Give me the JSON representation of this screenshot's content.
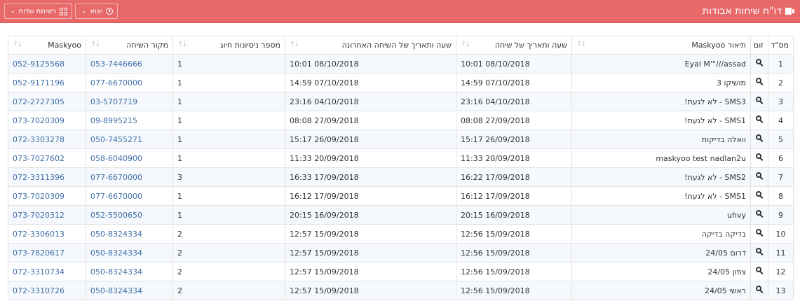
{
  "header": {
    "title": "דו\"ח שיחות אבודות",
    "export_label": "יצוא",
    "fields_label": "רשימת שדות"
  },
  "table": {
    "columns": {
      "index": "מס\"ד",
      "zoom": "זום",
      "maskyoo_desc": "תיאור Maskyoo",
      "call_time": "שעה ותאריך של שיחה",
      "last_call_time": "שעה ותאריך של השיחה האחרונה",
      "dial_attempts": "מספר ניסיונות חיוג",
      "call_source": "מקור השיחה",
      "maskyoo": "Maskyoo"
    },
    "rows": [
      {
        "index": "1",
        "desc": "Eyal M'\"///assad",
        "call_time": "08/10/2018 10:01",
        "last_time": "08/10/2018 10:01",
        "attempts": "1",
        "source": "053-7446666",
        "maskyoo": "052-9125568"
      },
      {
        "index": "2",
        "desc": "מושיקו 3",
        "call_time": "07/10/2018 14:59",
        "last_time": "07/10/2018 14:59",
        "attempts": "1",
        "source": "077-6670000",
        "maskyoo": "052-9171196"
      },
      {
        "index": "3",
        "desc": "SMS3 - לא לגעת!",
        "call_time": "04/10/2018 23:16",
        "last_time": "04/10/2018 23:16",
        "attempts": "1",
        "source": "03-5707719",
        "maskyoo": "072-2727305"
      },
      {
        "index": "4",
        "desc": "SMS1 - לא לגעת!",
        "call_time": "27/09/2018 08:08",
        "last_time": "27/09/2018 08:08",
        "attempts": "1",
        "source": "09-8995215",
        "maskyoo": "073-7020309"
      },
      {
        "index": "5",
        "desc": "וואלה בדיקות",
        "call_time": "26/09/2018 15:17",
        "last_time": "26/09/2018 15:17",
        "attempts": "1",
        "source": "050-7455271",
        "maskyoo": "072-3303278"
      },
      {
        "index": "6",
        "desc": "maskyoo test nadlan2u",
        "call_time": "20/09/2018 11:33",
        "last_time": "20/09/2018 11:33",
        "attempts": "1",
        "source": "058-6040900",
        "maskyoo": "073-7027602"
      },
      {
        "index": "7",
        "desc": "SMS2 - לא לגעת!",
        "call_time": "17/09/2018 16:22",
        "last_time": "17/09/2018 16:33",
        "attempts": "3",
        "source": "077-6670000",
        "maskyoo": "072-3311396"
      },
      {
        "index": "8",
        "desc": "SMS1 - לא לגעת!",
        "call_time": "17/09/2018 16:12",
        "last_time": "17/09/2018 16:12",
        "attempts": "1",
        "source": "077-6670000",
        "maskyoo": "073-7020309"
      },
      {
        "index": "9",
        "desc": "uhvy",
        "call_time": "16/09/2018 20:15",
        "last_time": "16/09/2018 20:15",
        "attempts": "1",
        "source": "052-5500650",
        "maskyoo": "073-7020312"
      },
      {
        "index": "10",
        "desc": "בדיקה בדיקה",
        "call_time": "15/09/2018 12:56",
        "last_time": "15/09/2018 12:57",
        "attempts": "2",
        "source": "050-8324334",
        "maskyoo": "072-3306013"
      },
      {
        "index": "11",
        "desc": "דרום 24/05",
        "call_time": "15/09/2018 12:56",
        "last_time": "15/09/2018 12:57",
        "attempts": "2",
        "source": "050-8324334",
        "maskyoo": "073-7820617"
      },
      {
        "index": "12",
        "desc": "צפון 24/05",
        "call_time": "15/09/2018 12:56",
        "last_time": "15/09/2018 12:57",
        "attempts": "2",
        "source": "050-8324334",
        "maskyoo": "072-3310734"
      },
      {
        "index": "13",
        "desc": "ראשי 24/05",
        "call_time": "15/09/2018 12:56",
        "last_time": "15/09/2018 12:57",
        "attempts": "2",
        "source": "050-8324334",
        "maskyoo": "072-3310726"
      }
    ]
  }
}
